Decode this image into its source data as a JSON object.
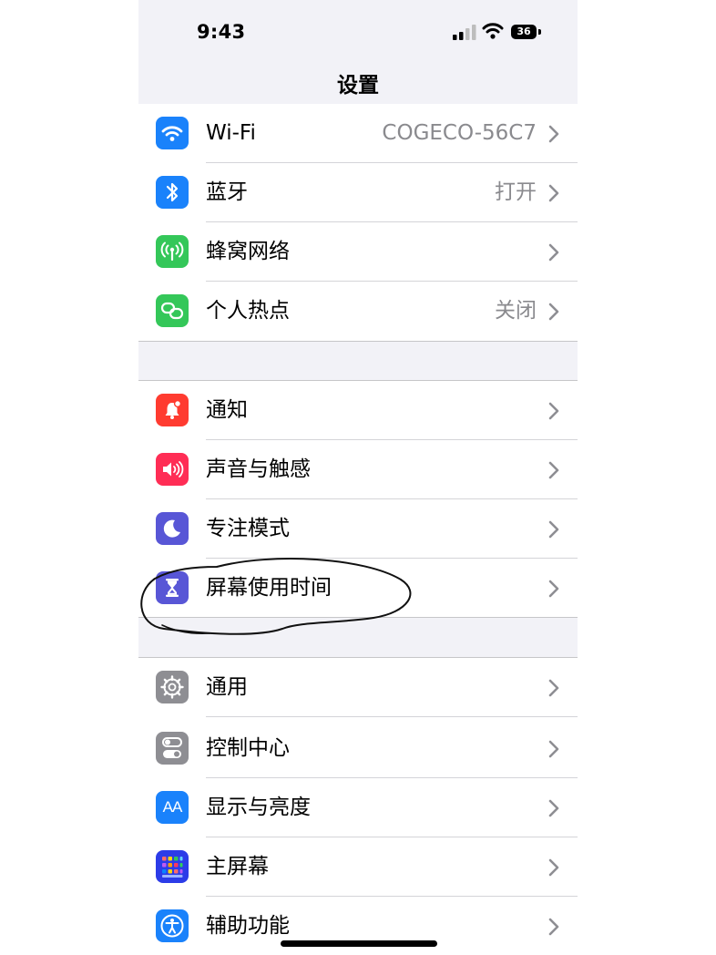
{
  "status_bar": {
    "time": "9:43",
    "battery": "36"
  },
  "nav": {
    "title": "设置"
  },
  "groups": [
    {
      "rows": [
        {
          "label": "Wi-Fi",
          "value": "COGECO-56C7",
          "icon": "wifi-icon",
          "color": "#1a82fb"
        },
        {
          "label": "蓝牙",
          "value": "打开",
          "icon": "bluetooth-icon",
          "color": "#1a82fb"
        },
        {
          "label": "蜂窝网络",
          "value": "",
          "icon": "antenna-icon",
          "color": "#34c759"
        },
        {
          "label": "个人热点",
          "value": "关闭",
          "icon": "hotspot-link-icon",
          "color": "#34c759"
        }
      ]
    },
    {
      "rows": [
        {
          "label": "通知",
          "value": "",
          "icon": "bell-icon",
          "color": "#ff3b30"
        },
        {
          "label": "声音与触感",
          "value": "",
          "icon": "speaker-icon",
          "color": "#ff2d55"
        },
        {
          "label": "专注模式",
          "value": "",
          "icon": "moon-icon",
          "color": "#5856d6"
        },
        {
          "label": "屏幕使用时间",
          "value": "",
          "icon": "hourglass-icon",
          "color": "#5856d6"
        }
      ]
    },
    {
      "rows": [
        {
          "label": "通用",
          "value": "",
          "icon": "gear-icon",
          "color": "#8e8e93"
        },
        {
          "label": "控制中心",
          "value": "",
          "icon": "toggles-icon",
          "color": "#8e8e93"
        },
        {
          "label": "显示与亮度",
          "value": "",
          "icon": "text-size-icon",
          "color": "#1a82fb"
        },
        {
          "label": "主屏幕",
          "value": "",
          "icon": "app-grid-icon",
          "color": "#2c3ce8"
        },
        {
          "label": "辅助功能",
          "value": "",
          "icon": "accessibility-icon",
          "color": "#1a82fb"
        }
      ]
    }
  ],
  "display_icon_text": "AA"
}
